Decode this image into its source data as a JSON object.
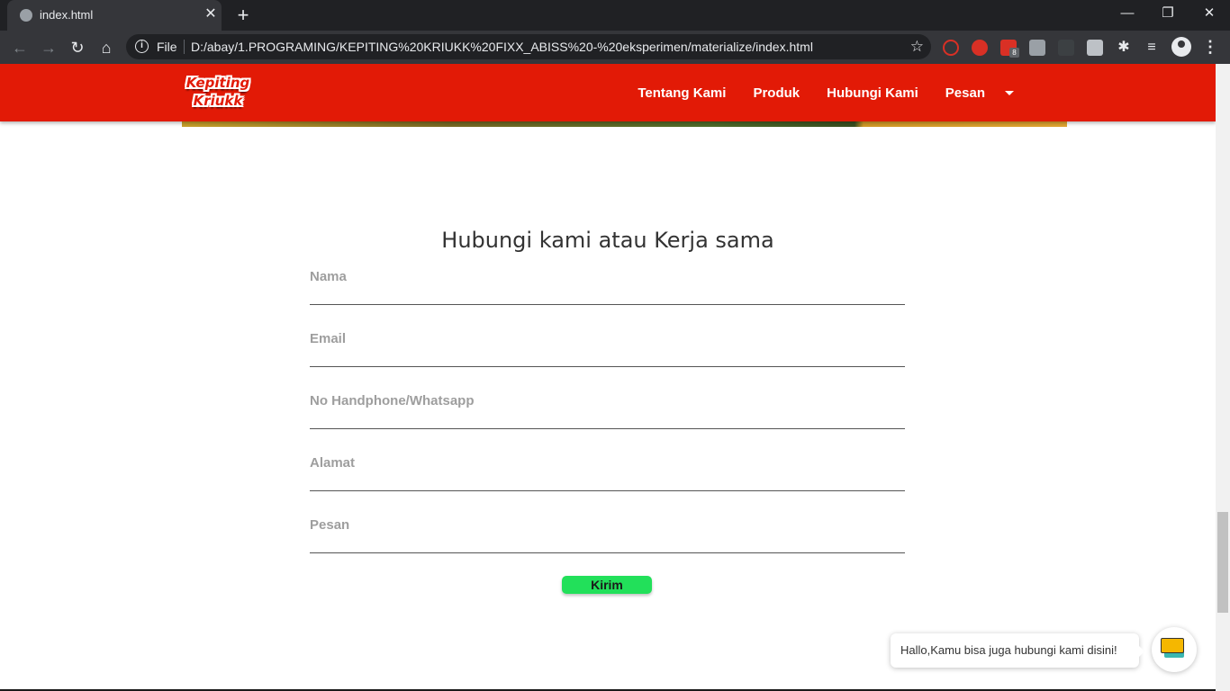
{
  "browser": {
    "tab_title": "index.html",
    "new_tab_symbol": "+",
    "close_tab_symbol": "✕",
    "address_scheme_label": "File",
    "url": "D:/abay/1.PROGRAMING/KEPITING%20KRIUKK%20FIXX_ABISS%20-%20eksperimen/materialize/index.html",
    "extension_badge": "8"
  },
  "site": {
    "logo_line1": "Kepiting",
    "logo_line2": "Kriukk",
    "nav": {
      "about": "Tentang Kami",
      "products": "Produk",
      "contact": "Hubungi Kami",
      "order": "Pesan"
    },
    "accent_color": "#e21a06"
  },
  "contact_form": {
    "title": "Hubungi kami atau Kerja sama",
    "fields": {
      "name": "Nama",
      "email": "Email",
      "phone": "No Handphone/Whatsapp",
      "address": "Alamat",
      "message": "Pesan"
    },
    "submit_label": "Kirim",
    "submit_color": "#22e05a"
  },
  "chat_widget": {
    "tooltip": "Hallo,Kamu bisa juga hubungi kami disini!"
  }
}
